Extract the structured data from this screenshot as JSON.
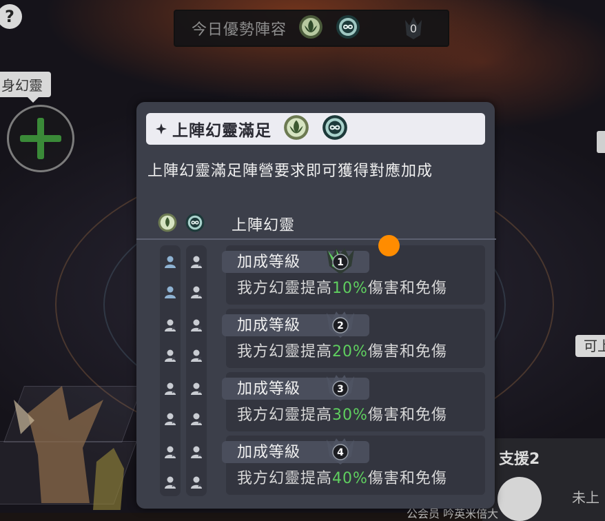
{
  "top_banner": {
    "title": "今日優勢陣容",
    "faction_icons": [
      "lotus-faction-icon",
      "infinity-faction-icon"
    ],
    "count": "0"
  },
  "help_button": {
    "label": "?"
  },
  "slot_label": "身幻靈",
  "right_label": "可上",
  "support_panel": {
    "title": "支援2",
    "side_text": "未上",
    "bottom_text": "公会员  吟英米倍大"
  },
  "popup": {
    "header_title": "上陣幻靈滿足",
    "description": "上陣幻靈滿足陣營要求即可獲得對應加成",
    "table_header_label": "上陣幻靈",
    "tiers": [
      {
        "label": "加成等級",
        "level": "1",
        "active": true,
        "desc_prefix": "我方幻靈提高",
        "percent": "10%",
        "desc_suffix": "傷害和免傷"
      },
      {
        "label": "加成等級",
        "level": "2",
        "active": false,
        "desc_prefix": "我方幻靈提高",
        "percent": "20%",
        "desc_suffix": "傷害和免傷"
      },
      {
        "label": "加成等級",
        "level": "3",
        "active": false,
        "desc_prefix": "我方幻靈提高",
        "percent": "30%",
        "desc_suffix": "傷害和免傷"
      },
      {
        "label": "加成等級",
        "level": "4",
        "active": false,
        "desc_prefix": "我方幻靈提高",
        "percent": "40%",
        "desc_suffix": "傷害和免傷"
      }
    ]
  },
  "colors": {
    "popup_bg": "#3c3f4a",
    "header_bg": "#ececf2",
    "highlight_green": "#5fcf5f",
    "touch_indicator": "#ff8c00"
  }
}
